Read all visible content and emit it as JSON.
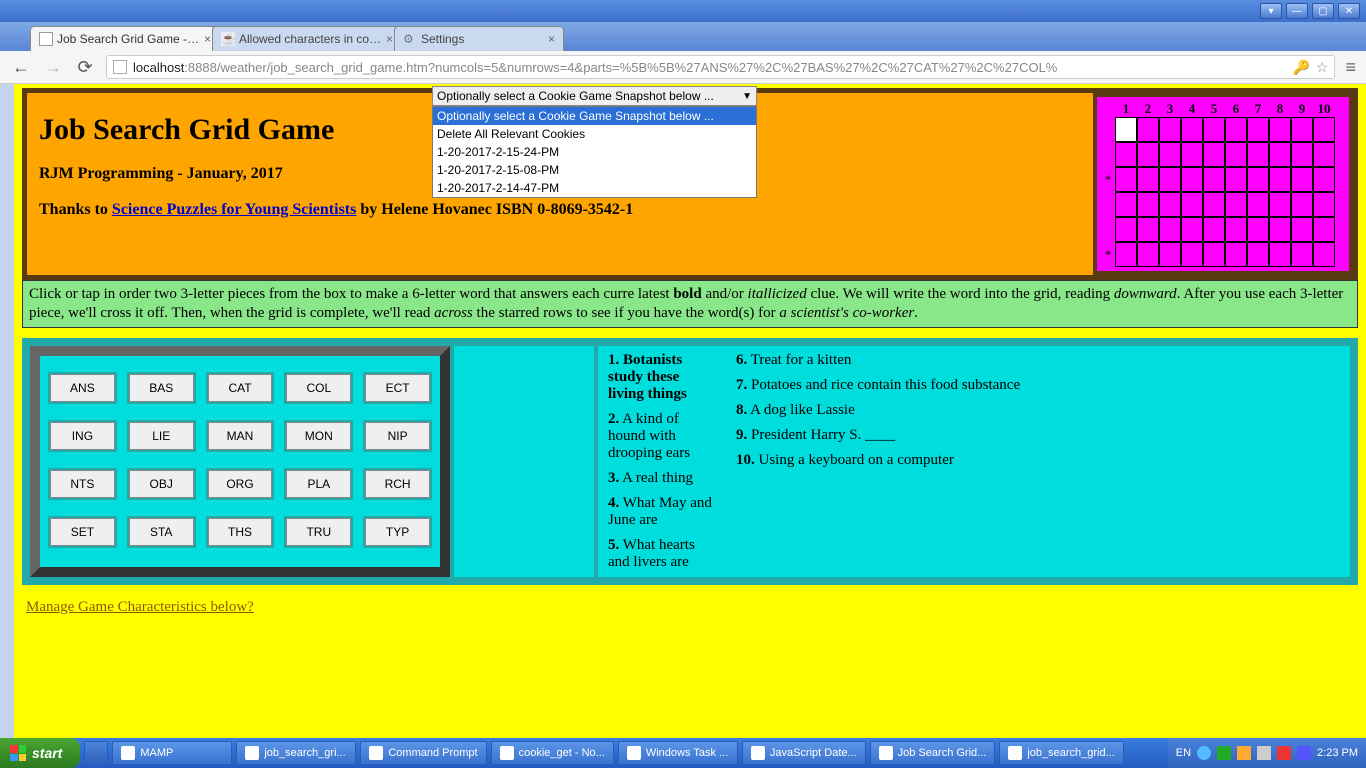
{
  "window": {
    "tabs": [
      {
        "label": "Job Search Grid Game - RJM"
      },
      {
        "label": "Allowed characters in cookie"
      },
      {
        "label": "Settings"
      }
    ],
    "url_host": "localhost",
    "url_path": ":8888/weather/job_search_grid_game.htm?numcols=5&numrows=4&parts=%5B%5B%27ANS%27%2C%27BAS%27%2C%27CAT%27%2C%27COL%"
  },
  "header": {
    "title": "Job Search Grid Game",
    "subtitle": "RJM Programming - January, 2017",
    "thanks_prefix": "Thanks to ",
    "thanks_link": "Science Puzzles for Young Scientists",
    "thanks_suffix": " by Helene Hovanec ISBN 0-8069-3542-1"
  },
  "snapshot": {
    "top": "Optionally select a Cookie Game Snapshot below ...",
    "options": [
      "Optionally select a Cookie Game Snapshot below ...",
      "Delete All Relevant Cookies",
      "1-20-2017-2-15-24-PM",
      "1-20-2017-2-15-08-PM",
      "1-20-2017-2-14-47-PM"
    ]
  },
  "grid": {
    "columns": [
      "1",
      "2",
      "3",
      "4",
      "5",
      "6",
      "7",
      "8",
      "9",
      "10"
    ],
    "star_rows": [
      2,
      5
    ],
    "rows": 6,
    "white_cell": {
      "row": 0,
      "col": 0
    }
  },
  "instructions": {
    "p1a": "Click or tap in order two 3-letter pieces from the box to make a 6-letter word that answers each curre latest ",
    "p1b_bold": "bold",
    "p1c": " and/or ",
    "p1d_ital": "itallicized",
    "p1e": " clue. We will write the word into the grid, reading ",
    "p1f_ital": "downward",
    "p1g": ". After you use each 3-letter piece, we'll cross it off. Then, when the grid is complete, we'll read ",
    "p1h_ital": "across",
    "p1i": " the starred rows to see if you have the word(s) for ",
    "p1j_ital": "a scientist's co-worker",
    "p1k": "."
  },
  "pieces": [
    "ANS",
    "BAS",
    "CAT",
    "COL",
    "ECT",
    "ING",
    "LIE",
    "MAN",
    "MON",
    "NIP",
    "NTS",
    "OBJ",
    "ORG",
    "PLA",
    "RCH",
    "SET",
    "STA",
    "THS",
    "TRU",
    "TYP"
  ],
  "clues_left": [
    {
      "n": "1.",
      "t": " Botanists study these living things",
      "bold": true
    },
    {
      "n": "2.",
      "t": " A kind of hound with drooping ears"
    },
    {
      "n": "3.",
      "t": " A real thing"
    },
    {
      "n": "4.",
      "t": " What May and June are"
    },
    {
      "n": "5.",
      "t": " What hearts and livers are"
    }
  ],
  "clues_right": [
    {
      "n": "6.",
      "t": " Treat for a kitten"
    },
    {
      "n": "7.",
      "t": " Potatoes and rice contain this food substance"
    },
    {
      "n": "8.",
      "t": " A dog like Lassie"
    },
    {
      "n": "9.",
      "t": " President Harry S. ____"
    },
    {
      "n": "10.",
      "t": " Using a keyboard on a computer"
    }
  ],
  "manage_link": "Manage Game Characteristics below?",
  "taskbar": {
    "start": "start",
    "items": [
      "MAMP",
      "job_search_gri...",
      "Command Prompt",
      "cookie_get - No...",
      "Windows Task ...",
      "JavaScript Date...",
      "Job Search Grid...",
      "job_search_grid..."
    ],
    "lang": "EN",
    "clock": "2:23 PM"
  }
}
